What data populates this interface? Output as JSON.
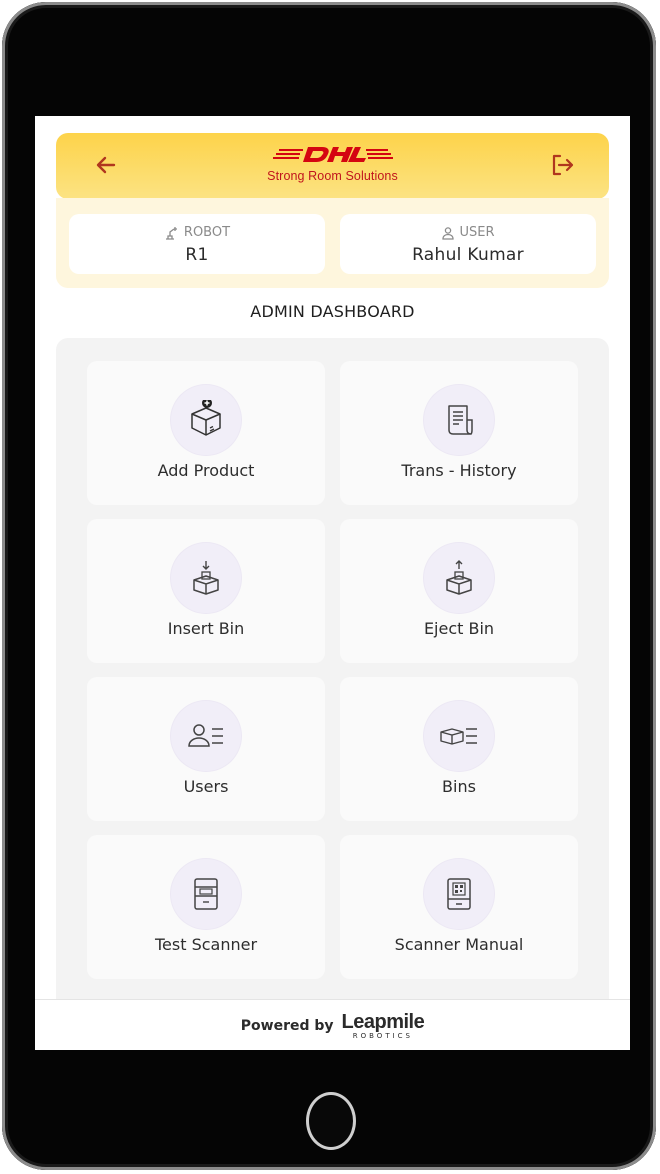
{
  "header": {
    "brand_logo": "DHL",
    "brand_subtitle": "Strong Room Solutions",
    "back_icon": "arrow-left-icon",
    "logout_icon": "logout-icon",
    "accent_color": "#FFCC00",
    "brand_color": "#D40511"
  },
  "info": {
    "robot_label": "ROBOT",
    "robot_value": "R1",
    "user_label": "USER",
    "user_value": "Rahul Kumar"
  },
  "dashboard": {
    "title": "ADMIN DASHBOARD",
    "tiles": [
      {
        "label": "Add Product",
        "icon": "add-box-icon"
      },
      {
        "label": "Trans - History",
        "icon": "receipt-icon"
      },
      {
        "label": "Insert Bin",
        "icon": "insert-bin-icon"
      },
      {
        "label": "Eject Bin",
        "icon": "eject-bin-icon"
      },
      {
        "label": "Users",
        "icon": "users-list-icon"
      },
      {
        "label": "Bins",
        "icon": "bins-list-icon"
      },
      {
        "label": "Test Scanner",
        "icon": "scanner-icon"
      },
      {
        "label": "Scanner Manual",
        "icon": "qr-scanner-icon"
      }
    ]
  },
  "footer": {
    "powered_by": "Powered by",
    "company_name": "Leapmile",
    "company_sub": "ROBOTICS"
  }
}
